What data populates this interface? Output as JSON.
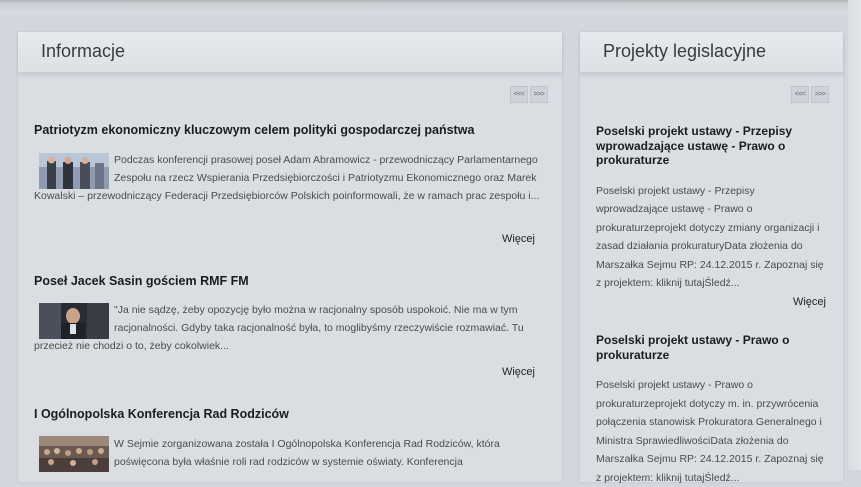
{
  "left_panel": {
    "title": "Informacje",
    "nav": {
      "prev": "<<<",
      "next": ">>>"
    },
    "articles": [
      {
        "title": "Patriotyzm ekonomiczny kluczowym celem polityki gospodarczej państwa",
        "text": "Podczas konferencji prasowej poseł Adam Abramowicz - przewodniczący Parlamentarnego Zespołu na rzecz Wspierania Przedsiębiorczości i Patriotyzmu Ekonomicznego oraz Marek Kowalski – przewodniczący Federacji Przedsiębiorców Polskich poinformowali, że w ramach prac zespołu i...",
        "more": "Więcej"
      },
      {
        "title": "Poseł Jacek Sasin gościem RMF FM",
        "text": "\"Ja nie sądzę, żeby opozycję było można w racjonalny sposób uspokoić. Nie ma w tym racjonalności. Gdyby taka racjonalność była, to moglibyśmy rzeczywiście rozmawiać. Tu przecież nie chodzi o to, żeby cokolwiek...",
        "more": "Więcej"
      },
      {
        "title": "I Ogólnopolska Konferencja Rad Rodziców",
        "text": "W Sejmie zorganizowana została I Ogólnopolska Konferencja Rad Rodziców, która poświęcona była właśnie roli rad rodziców w systemie oświaty. Konferencja",
        "more": ""
      }
    ]
  },
  "right_panel": {
    "title": "Projekty legislacyjne",
    "nav": {
      "prev": "<<<",
      "next": ">>>"
    },
    "projects": [
      {
        "title": "Poselski projekt ustawy - Przepisy wprowadzające ustawę - Prawo o prokuraturze",
        "text": "Poselski projekt ustawy - Przepisy wprowadzające ustawę - Prawo o prokuraturzeprojekt dotyczy zmiany organizacji i zasad działania prokuraturyData złożenia do Marszałka Sejmu RP: 24.12.2015 r. Zapoznaj się z projektem: kliknij tutajŚledź...",
        "more": "Więcej"
      },
      {
        "title": "Poselski projekt ustawy - Prawo o prokuraturze",
        "text": "Poselski projekt ustawy - Prawo o prokuraturzeprojekt dotyczy m. in. przywrócenia połączenia stanowisk Prokuratora Generalnego i Ministra SprawiedliwościData złożenia do Marszałka Sejmu RP: 24.12.2015 r. Zapoznaj się z projektem: kliknij tutajŚledź...",
        "more": ""
      }
    ]
  },
  "colors": {
    "background": "#d3d7dd",
    "panel": "#dadee3",
    "text": "#4a4a4a",
    "heading": "#1c1c1c"
  }
}
